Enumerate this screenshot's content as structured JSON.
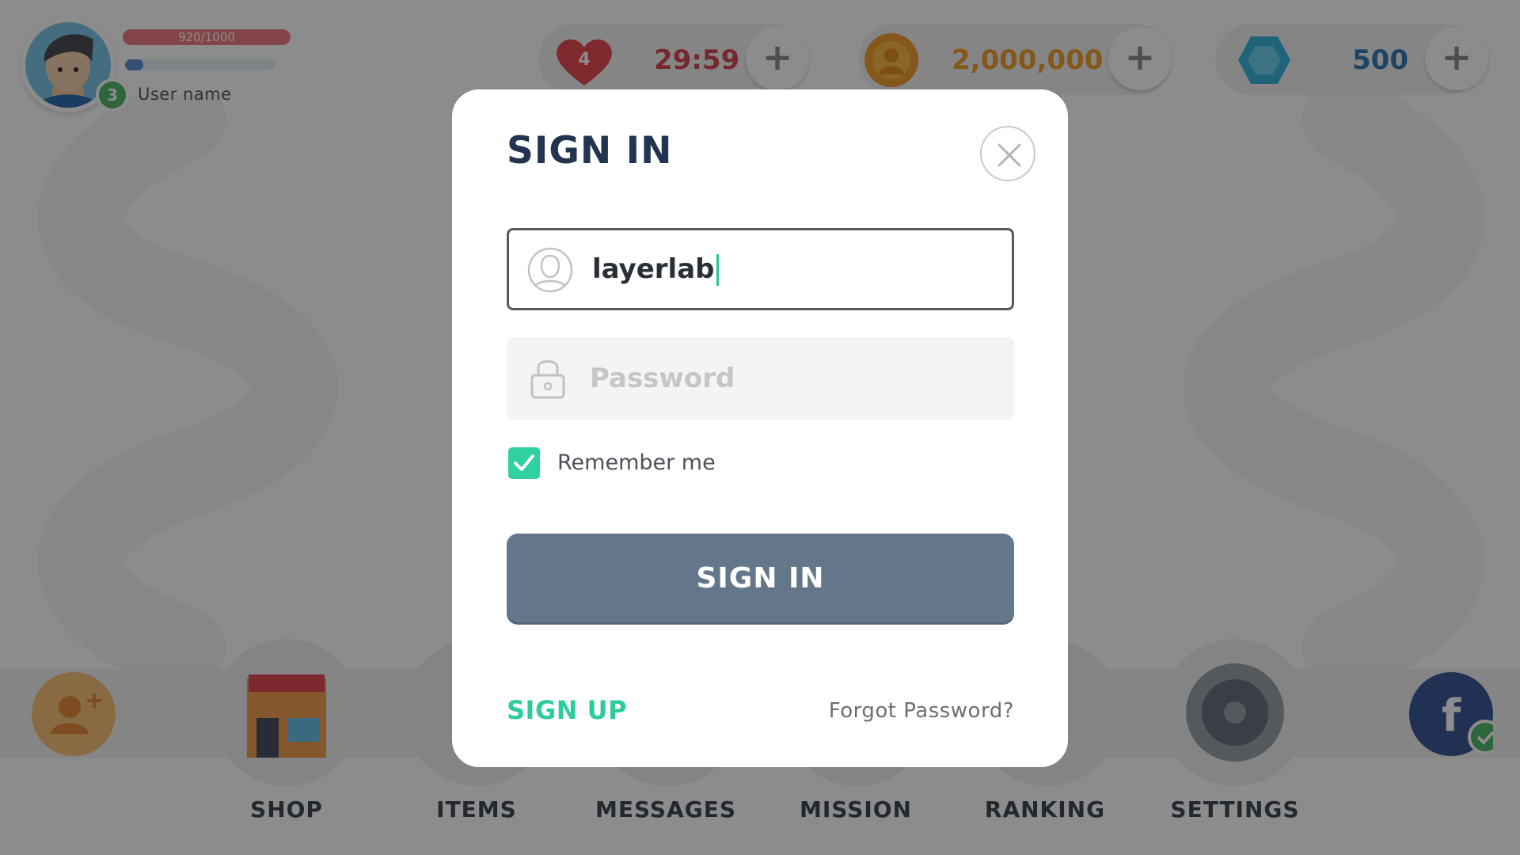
{
  "profile": {
    "xp": "920/1000",
    "xp_fraction": 0.92,
    "mp_fraction": 0.12,
    "level": "3",
    "username": "User name"
  },
  "resources": {
    "hearts": "4",
    "timer": "29:59",
    "coins": "2,000,000",
    "gems": "500"
  },
  "nav": {
    "items": [
      {
        "label": "SHOP"
      },
      {
        "label": "ITEMS"
      },
      {
        "label": "MESSAGES"
      },
      {
        "label": "MISSION"
      },
      {
        "label": "RANKING"
      },
      {
        "label": "SETTINGS"
      }
    ]
  },
  "modal": {
    "title": "SIGN IN",
    "username_value": "layerlab",
    "password_placeholder": "Password",
    "remember_label": "Remember me",
    "remember_checked": true,
    "submit_label": "SIGN IN",
    "signup_label": "SIGN UP",
    "forgot_label": "Forgot Password?"
  },
  "colors": {
    "overlay": "#000000",
    "accent_green": "#2ed19f",
    "button": "#647689",
    "title": "#22344f",
    "heart": "#e64b55",
    "coin": "#f0a030",
    "gem": "#3ab7e0"
  },
  "icons": {
    "close": "close-icon",
    "user": "user-icon",
    "lock": "lock-icon",
    "check": "check-icon"
  }
}
